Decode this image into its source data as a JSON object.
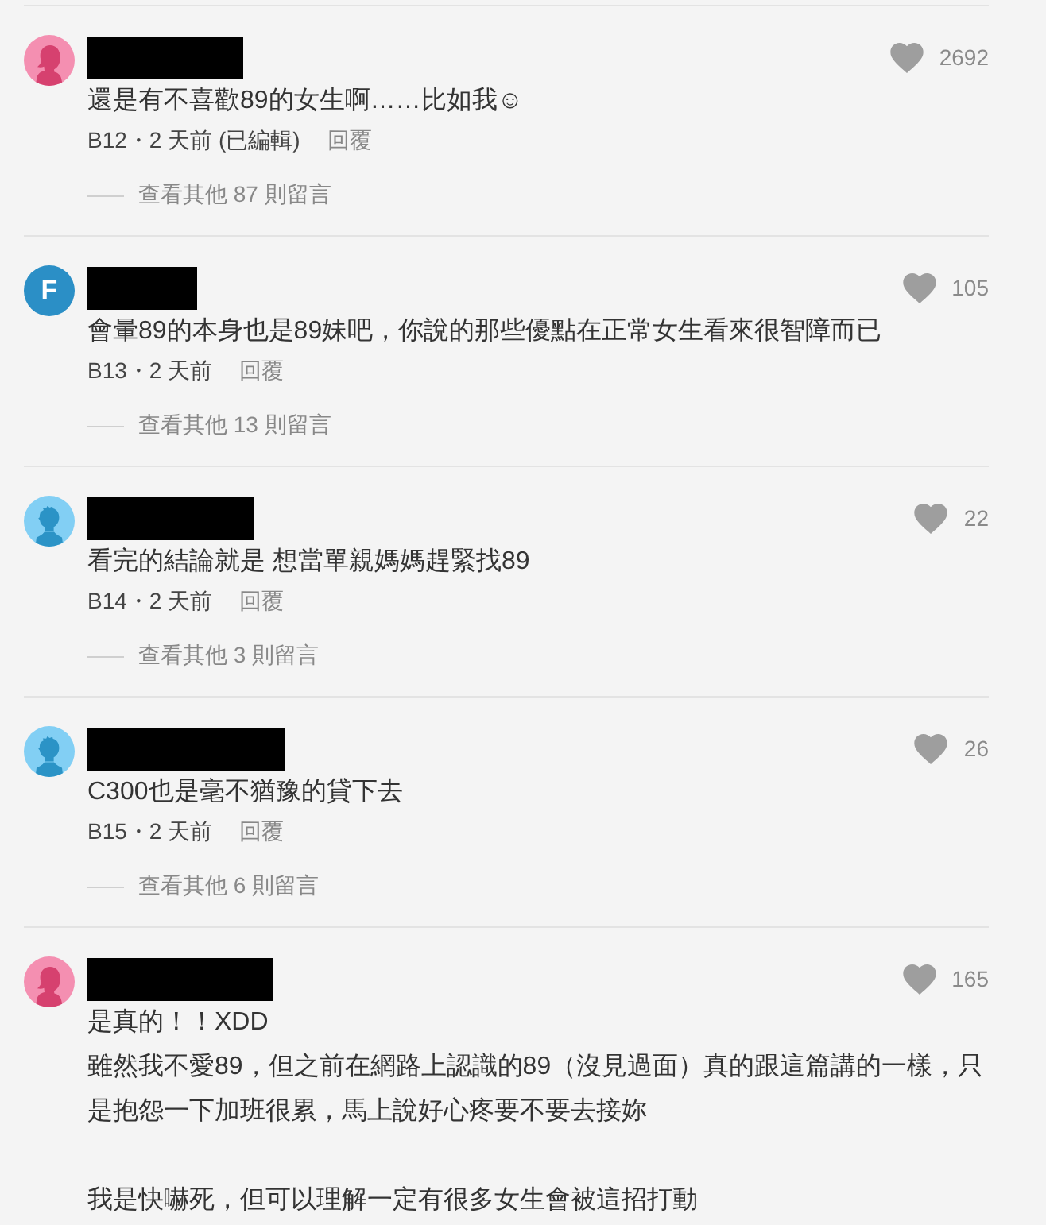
{
  "comments": [
    {
      "avatar": {
        "kind": "female"
      },
      "name_redacted": true,
      "likes": {
        "liked": false,
        "count": "2692"
      },
      "paragraphs": [
        [
          "還是有不喜歡89的女生啊……比如我☺"
        ]
      ],
      "meta": "B12・2 天前 (已編輯)",
      "reply": "回覆",
      "more_replies": "查看其他 87 則留言"
    },
    {
      "avatar": {
        "kind": "letter",
        "letter": "F"
      },
      "name_redacted": true,
      "likes": {
        "liked": false,
        "count": "105"
      },
      "paragraphs": [
        [
          "會暈89的本身也是89妹吧，你說的那些優點在正常女生看來很智障而已"
        ]
      ],
      "meta": "B13・2 天前",
      "reply": "回覆",
      "more_replies": "查看其他 13 則留言"
    },
    {
      "avatar": {
        "kind": "male"
      },
      "name_redacted": true,
      "likes": {
        "liked": false,
        "count": "22"
      },
      "paragraphs": [
        [
          "看完的結論就是 想當單親媽媽趕緊找89"
        ]
      ],
      "meta": "B14・2 天前",
      "reply": "回覆",
      "more_replies": "查看其他 3 則留言"
    },
    {
      "avatar": {
        "kind": "male"
      },
      "name_redacted": true,
      "likes": {
        "liked": false,
        "count": "26"
      },
      "paragraphs": [
        [
          "C300也是毫不猶豫的貸下去"
        ]
      ],
      "meta": "B15・2 天前",
      "reply": "回覆",
      "more_replies": "查看其他 6 則留言"
    },
    {
      "avatar": {
        "kind": "female"
      },
      "name_redacted": true,
      "likes": {
        "liked": false,
        "count": "165"
      },
      "paragraphs": [
        [
          "是真的！！XDD",
          "雖然我不愛89，但之前在網路上認識的89（沒見過面）真的跟這篇講的一樣，只是抱怨一下加班很累，馬上說好心疼要不要去接妳"
        ],
        [
          "我是快嚇死，但可以理解一定有很多女生會被這招打動"
        ]
      ]
    }
  ]
}
